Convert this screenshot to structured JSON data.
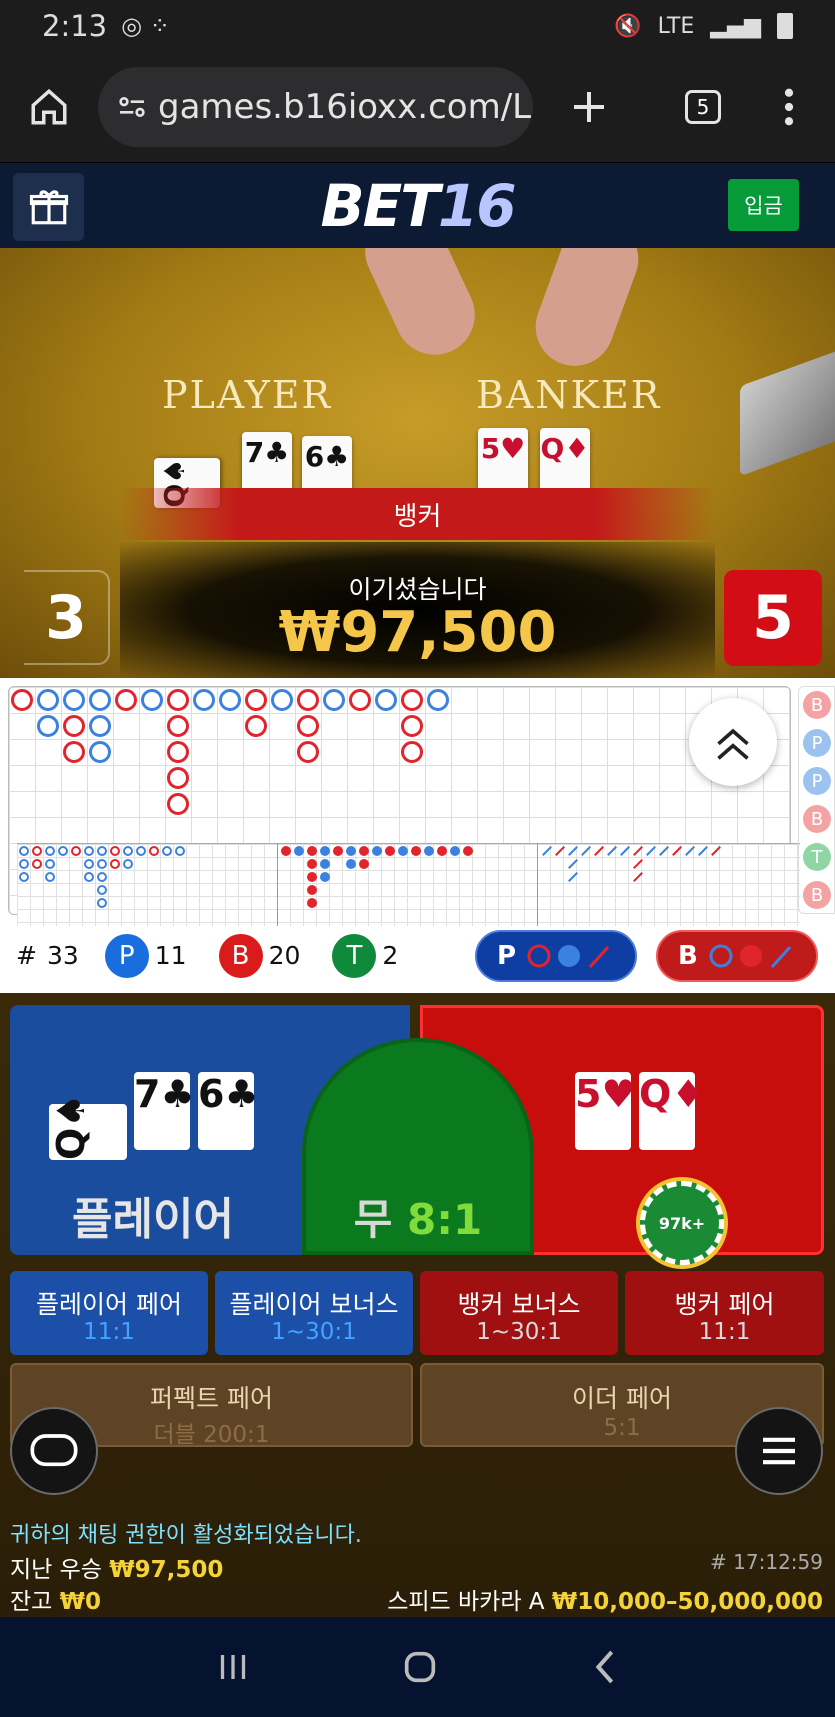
{
  "status_bar": {
    "time": "2:13",
    "network": "LTE"
  },
  "browser": {
    "url": "games.b16ioxx.com/L",
    "tab_count": "5"
  },
  "header": {
    "logo_a": "BET",
    "logo_b": "16",
    "deposit": "입금"
  },
  "video": {
    "player_label": "PLAYER",
    "banker_label": "BANKER",
    "player_cards": [
      "Q♠",
      "7♣",
      "6♣"
    ],
    "banker_cards": [
      "5♥",
      "Q♦"
    ],
    "winner_label": "뱅커",
    "win_text": "이기셨습니다",
    "win_amount": "₩97,500",
    "player_score": "3",
    "banker_score": "5"
  },
  "roadmap": {
    "side_letters": [
      "B",
      "P",
      "P",
      "B",
      "T",
      "B"
    ],
    "stats": {
      "hash": "#",
      "total": "33",
      "p_label": "P",
      "p_count": "11",
      "b_label": "B",
      "b_count": "20",
      "t_label": "T",
      "t_count": "2"
    },
    "player_ask": "P",
    "banker_ask": "B"
  },
  "betting": {
    "player_cards": [
      "Q♠",
      "7♣",
      "6♣"
    ],
    "banker_cards": [
      "5♥",
      "Q♦"
    ],
    "player_label": "플레이어",
    "tie_label": "무",
    "tie_odds": "8:1",
    "chip_label": "97k+",
    "side_bets": [
      {
        "label": "플레이어 페어",
        "odds": "11:1"
      },
      {
        "label": "플레이어 보너스",
        "odds": "1~30:1"
      },
      {
        "label": "뱅커 보너스",
        "odds": "1~30:1"
      },
      {
        "label": "뱅커 페어",
        "odds": "11:1"
      }
    ],
    "perfect_pair": {
      "label": "퍼펙트 페어",
      "odds": "더블 200:1"
    },
    "either_pair": {
      "label": "이더 페어",
      "odds": "5:1"
    }
  },
  "footer": {
    "chat_notice": "귀하의 채팅 권한이 활성화되었습니다.",
    "last_win_label": "지난 우승",
    "last_win_value": "₩97,500",
    "round_id": "# 17:12:59",
    "balance_label": "잔고",
    "balance_value": "₩0",
    "table_name": "스피드 바카라 A",
    "table_limits": "₩10,000–50,000,000"
  },
  "colors": {
    "player": "#1a4d9e",
    "banker": "#c80d0d",
    "tie": "#0b7a1e",
    "gold": "#f4d23a"
  }
}
